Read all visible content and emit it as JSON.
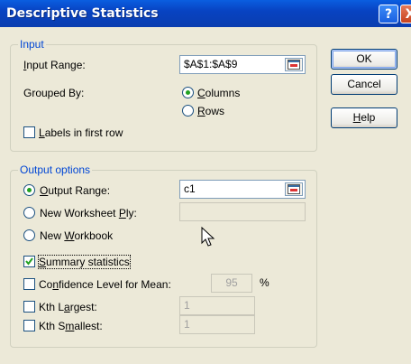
{
  "window": {
    "title": "Descriptive Statistics",
    "help_glyph": "?",
    "close_glyph": "X"
  },
  "input_group": {
    "legend": "Input",
    "input_range_label": "Input Range:",
    "input_range_value": "$A$1:$A$9",
    "grouped_by_label": "Grouped By:",
    "columns_label": "Columns",
    "rows_label": "Rows",
    "grouped_by_selected": "Columns",
    "labels_first_row_label": "Labels in first row",
    "labels_first_row_checked": false
  },
  "output_group": {
    "legend": "Output options",
    "output_range_label": "Output Range:",
    "output_range_value": "c1",
    "new_worksheet_label": "New Worksheet Ply:",
    "new_worksheet_value": "",
    "new_workbook_label": "New Workbook",
    "selected_option": "Output Range",
    "summary_stats_label": "Summary statistics",
    "summary_stats_checked": true,
    "confidence_label": "Confidence Level for Mean:",
    "confidence_value": "95",
    "confidence_unit": "%",
    "confidence_checked": false,
    "kth_largest_label": "Kth Largest:",
    "kth_largest_value": "1",
    "kth_largest_checked": false,
    "kth_smallest_label": "Kth Smallest:",
    "kth_smallest_value": "1",
    "kth_smallest_checked": false
  },
  "buttons": {
    "ok": "OK",
    "cancel": "Cancel",
    "help": "Help"
  }
}
